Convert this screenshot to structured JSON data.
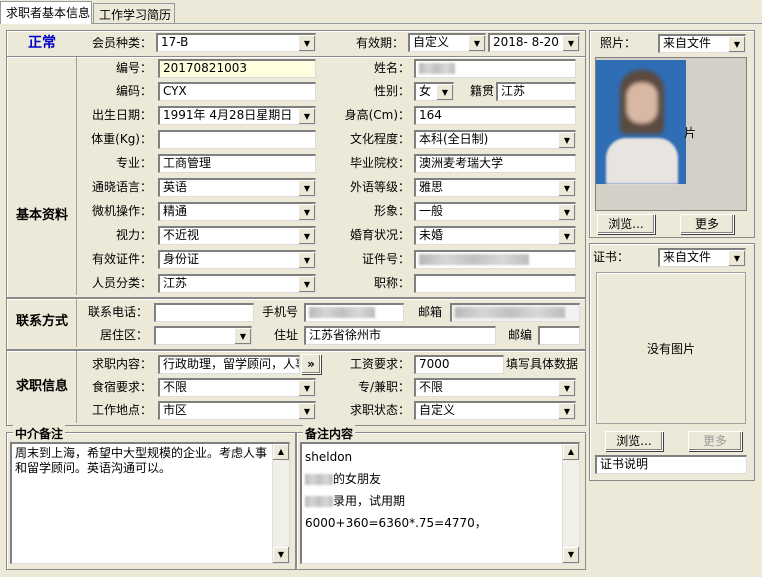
{
  "tabs": [
    {
      "label": "求职者基本信息"
    },
    {
      "label": "工作学习简历"
    }
  ],
  "status": "正常",
  "sections": {
    "basic": "基本资料",
    "contact": "联系方式",
    "job": "求职信息"
  },
  "fields": {
    "member_type_label": "会员种类：",
    "member_type": "17-B",
    "validity_label": "有效期：",
    "validity_mode": "自定义",
    "validity_date": "2018- 8-20",
    "number_label": "编号：",
    "number": "20170821003",
    "name_label": "姓名：",
    "code_label": "编码：",
    "code": "CYX",
    "gender_label": "性别：",
    "gender": "女",
    "native_label": "籍贯",
    "native": "江苏",
    "birth_label": "出生日期：",
    "birth": "1991年 4月28日星期日",
    "height_label": "身高(Cm)：",
    "height": "164",
    "weight_label": "体重(Kg)：",
    "weight": "",
    "education_label": "文化程度：",
    "education": "本科(全日制)",
    "major_label": "专业：",
    "major": "工商管理",
    "school_label": "毕业院校：",
    "school": "澳洲麦考瑞大学",
    "language_label": "通晓语言：",
    "language": "英语",
    "lang_level_label": "外语等级：",
    "lang_level": "雅思",
    "computer_label": "微机操作：",
    "computer": "精通",
    "appearance_label": "形象：",
    "appearance": "一般",
    "vision_label": "视力：",
    "vision": "不近视",
    "marital_label": "婚育状况：",
    "marital": "未婚",
    "id_type_label": "有效证件：",
    "id_type": "身份证",
    "id_no_label": "证件号：",
    "category_label": "人员分类：",
    "category": "江苏",
    "title_label": "职称：",
    "title": ""
  },
  "contact": {
    "phone_label": "联系电话：",
    "phone": "",
    "mobile_label": "手机号",
    "email_label": "邮箱",
    "district_label": "居住区：",
    "district": "",
    "address_label": "住址",
    "address": "江苏省徐州市",
    "zip_label": "邮编",
    "zip": ""
  },
  "job": {
    "content_label": "求职内容：",
    "content": "行政助理，留学顾问，人事专",
    "more_label": "»",
    "salary_label": "工资要求：",
    "salary": "7000",
    "salary_hint": "填写具体数据",
    "board_label": "食宿要求：",
    "board": "不限",
    "parttime_label": "专/兼职：",
    "parttime": "不限",
    "location_label": "工作地点：",
    "location": "市区",
    "status_label": "求职状态：",
    "status": "自定义"
  },
  "notes": {
    "agency_title": "中介备注",
    "agency_text": "周末到上海，希望中大型规模的企业。考虑人事和留学顾问。英语沟通可以。",
    "remark_title": "备注内容",
    "remark_line1": "sheldon",
    "remark_line2": "的女朋友",
    "remark_line3": "录用，试用期6000+360=6360*.75=4770，"
  },
  "photo": {
    "label": "照片：",
    "source": "来自文件",
    "side_text": "片",
    "browse": "浏览...",
    "more": "更多"
  },
  "certificate": {
    "label": "证书：",
    "source": "来自文件",
    "empty_text": "没有图片",
    "browse": "浏览...",
    "more": "更多",
    "desc": "证书说明"
  },
  "colors": {
    "status": "#0000cc",
    "window_bg": "#ece9d8"
  }
}
